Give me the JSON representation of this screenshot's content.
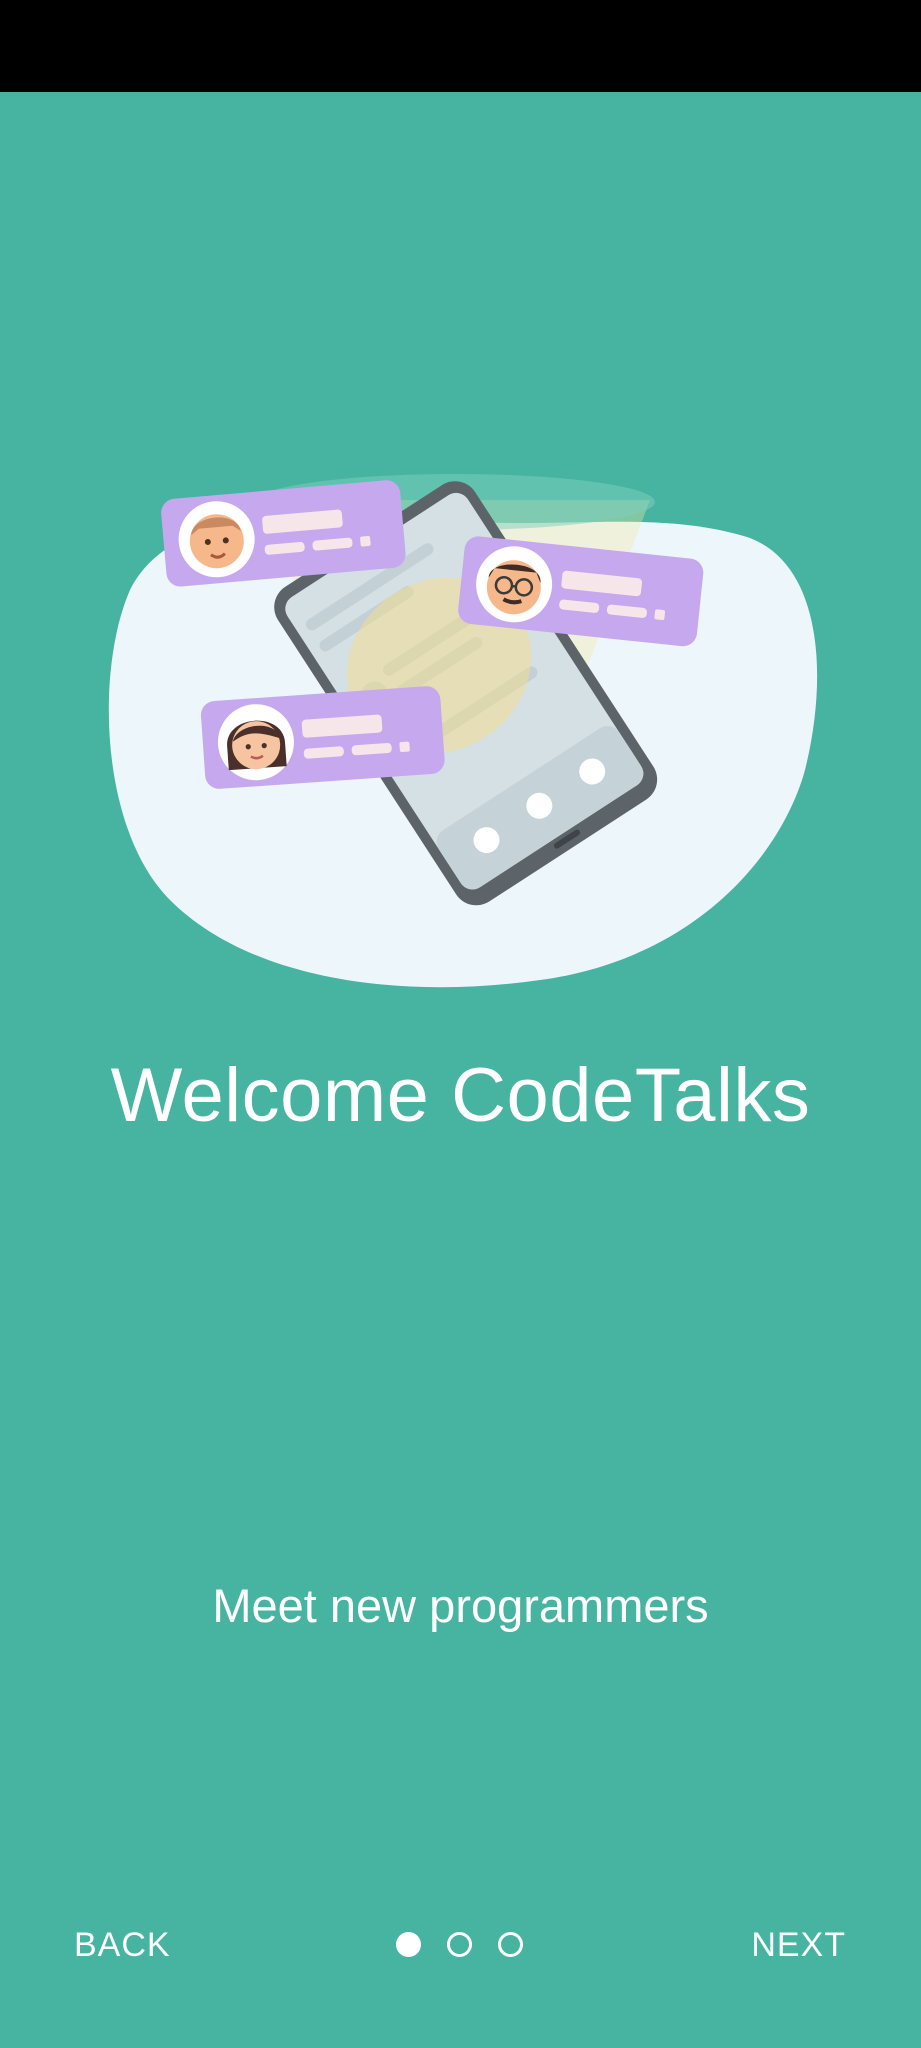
{
  "onboarding": {
    "title": "Welcome CodeTalks",
    "subtitle": "Meet new programmers",
    "back_label": "BACK",
    "next_label": "NEXT",
    "pages_total": 3,
    "current_page": 1
  },
  "colors": {
    "background": "#46b4a0",
    "bubble": "#c6a8ef",
    "blob": "#edf6fb",
    "phone_frame": "#5d6469",
    "text": "#ffffff"
  }
}
